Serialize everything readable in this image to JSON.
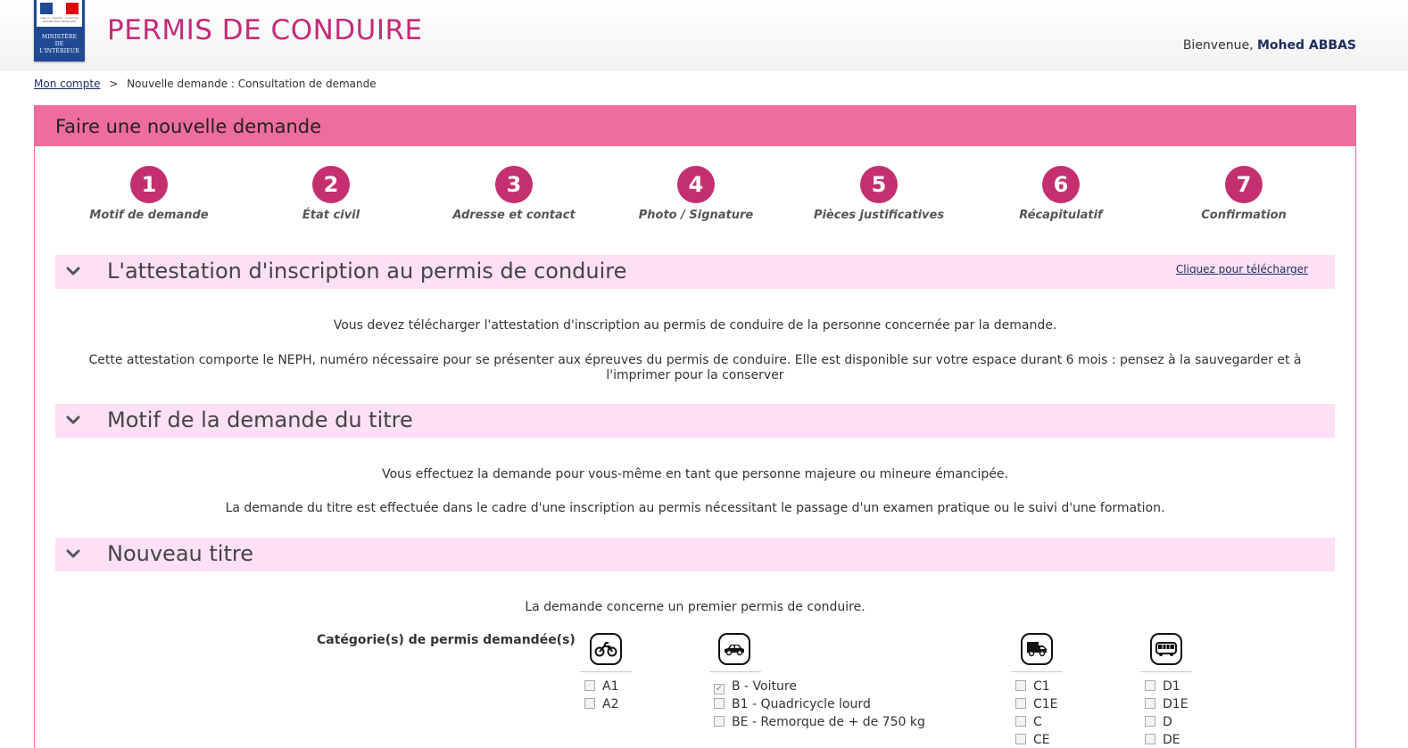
{
  "header": {
    "title": "PERMIS DE CONDUIRE",
    "logo_text": [
      "MINISTÈRE",
      "DE",
      "L'INTÉRIEUR"
    ],
    "logo_motto": "Liberté • Égalité • Fraternité RÉPUBLIQUE FRANÇAISE",
    "welcome_prefix": "Bienvenue,",
    "user_name": "Mohed ABBAS"
  },
  "breadcrumb": {
    "link": "Mon compte",
    "separator": ">",
    "current": "Nouvelle demande : Consultation de demande"
  },
  "panel": {
    "title": "Faire une nouvelle demande"
  },
  "steps": [
    {
      "number": "1",
      "label": "Motif de demande"
    },
    {
      "number": "2",
      "label": "État civil"
    },
    {
      "number": "3",
      "label": "Adresse et contact"
    },
    {
      "number": "4",
      "label": "Photo / Signature"
    },
    {
      "number": "5",
      "label": "Pièces justificatives"
    },
    {
      "number": "6",
      "label": "Récapitulatif"
    },
    {
      "number": "7",
      "label": "Confirmation"
    }
  ],
  "sections": {
    "attestation": {
      "title": "L'attestation d'inscription au permis de conduire",
      "download_link": "Cliquez pour télécharger",
      "text1": "Vous devez télécharger l'attestation d'inscription au permis de conduire de la personne concernée par la demande.",
      "text2a": "Cette attestation comporte le NEPH, numéro nécessaire pour se présenter aux épreuves du permis de conduire. Elle est disponible sur votre espace durant 6 mois : pensez à la sauvegarder et à",
      "text2b": "l'imprimer pour la conserver"
    },
    "motif": {
      "title": "Motif de la demande du titre",
      "text1": "Vous effectuez la demande pour vous-même en tant que personne majeure ou mineure émancipée.",
      "text2": "La demande du titre est effectuée dans le cadre d'une inscription au permis nécessitant le passage d'un examen pratique ou le suivi d'une formation."
    },
    "nouveau": {
      "title": "Nouveau titre",
      "text1": "La demande concerne un premier permis de conduire.",
      "categories_label": "Catégorie(s) de permis demandée(s)"
    }
  },
  "categories": {
    "moto": [
      {
        "label": "A1",
        "checked": false
      },
      {
        "label": "A2",
        "checked": false
      }
    ],
    "voiture": [
      {
        "label": "B - Voiture",
        "checked": true
      },
      {
        "label": "B1 - Quadricycle lourd",
        "checked": false
      },
      {
        "label": "BE - Remorque de + de 750 kg",
        "checked": false
      }
    ],
    "camion": [
      {
        "label": "C1",
        "checked": false
      },
      {
        "label": "C1E",
        "checked": false
      },
      {
        "label": "C",
        "checked": false
      },
      {
        "label": "CE",
        "checked": false
      }
    ],
    "bus": [
      {
        "label": "D1",
        "checked": false
      },
      {
        "label": "D1E",
        "checked": false
      },
      {
        "label": "D",
        "checked": false
      },
      {
        "label": "DE",
        "checked": false
      }
    ]
  },
  "colors": {
    "brand_pink": "#c52b78",
    "panel_pink": "#ee6d9c",
    "section_bg": "#fde0f5",
    "step_circle": "#c4306f",
    "navy": "#1b2e5e"
  }
}
